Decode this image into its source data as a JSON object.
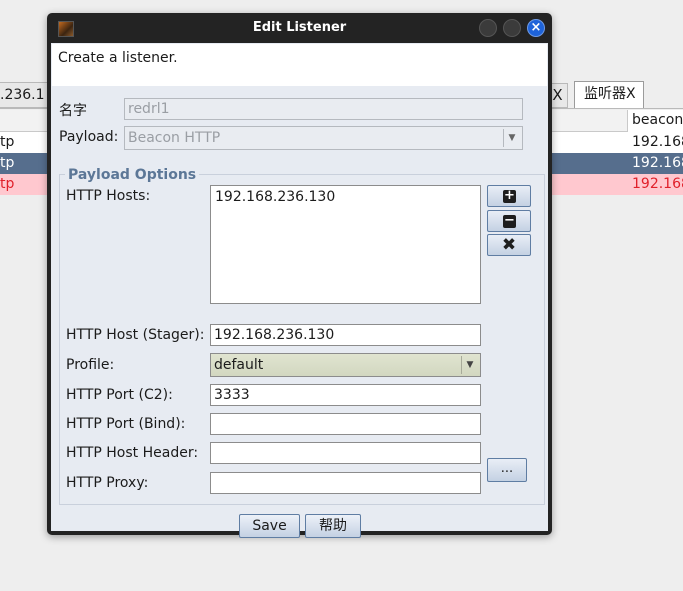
{
  "background": {
    "ip_tab": ".236.1",
    "close_tab_mark": "X",
    "active_tab": "监听器X",
    "header_beacon": "beacon",
    "rows": [
      {
        "left": "tp",
        "right": "192.168"
      },
      {
        "left": "tp",
        "right": "192.168"
      },
      {
        "left": "tp",
        "right": "192.168"
      }
    ]
  },
  "dialog": {
    "title": "Edit Listener",
    "close_mark": "×",
    "description": "Create a listener.",
    "name_label": "名字",
    "name_value": "redrl1",
    "payload_label": "Payload:",
    "payload_value": "Beacon HTTP",
    "group_title": "Payload Options",
    "hosts_label": "HTTP Hosts:",
    "hosts": [
      "192.168.236.130"
    ],
    "add_host_glyph": "+",
    "remove_host_glyph": "−",
    "clear_hosts_glyph": "✖",
    "stager_label": "HTTP Host (Stager):",
    "stager_value": "192.168.236.130",
    "profile_label": "Profile:",
    "profile_value": "default",
    "port_c2_label": "HTTP Port (C2):",
    "port_c2_value": "3333",
    "port_bind_label": "HTTP Port (Bind):",
    "port_bind_value": "",
    "host_header_label": "HTTP Host Header:",
    "host_header_value": "",
    "proxy_label": "HTTP Proxy:",
    "proxy_value": "",
    "proxy_button": "...",
    "save_button": "Save",
    "help_button": "帮助"
  },
  "colors": {
    "selected_row": "#566e8d",
    "error_row_bg": "#ffc8cf",
    "error_row_text": "#e0202a",
    "group_title": "#5c7797",
    "close_button": "#1e63d9"
  }
}
